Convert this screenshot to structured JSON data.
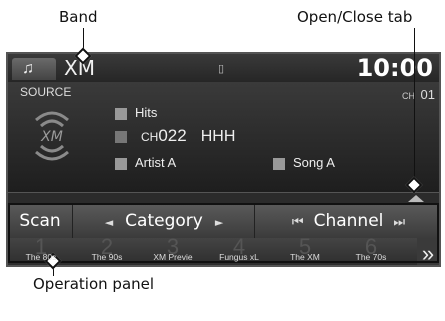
{
  "callouts": {
    "band": "Band",
    "open_close_tab": "Open/Close tab",
    "operation_panel": "Operation panel"
  },
  "topbar": {
    "music_icon": "♫",
    "band": "XM",
    "phone_icon": "▯",
    "clock": "10:00"
  },
  "info": {
    "source_label": "SOURCE",
    "category": "Hits",
    "channel_prefix": "CH",
    "channel_number": "022",
    "channel_name": "HHH",
    "artist": "Artist A",
    "song": "Song A",
    "ch_top_label": "CH",
    "ch_top_number": "01"
  },
  "operation": {
    "scan": "Scan",
    "category": "Category",
    "channel": "Channel",
    "left_arrow": "◄",
    "right_arrow": "►",
    "skip_back": "⏮",
    "skip_fwd": "⏭"
  },
  "presets": [
    {
      "num": "1",
      "label": "The 80s"
    },
    {
      "num": "2",
      "label": "The 90s"
    },
    {
      "num": "3",
      "label": "XM Previe"
    },
    {
      "num": "4",
      "label": "Fungus xL"
    },
    {
      "num": "5",
      "label": "The XM"
    },
    {
      "num": "6",
      "label": "The 70s"
    }
  ],
  "next_arrow": "»"
}
